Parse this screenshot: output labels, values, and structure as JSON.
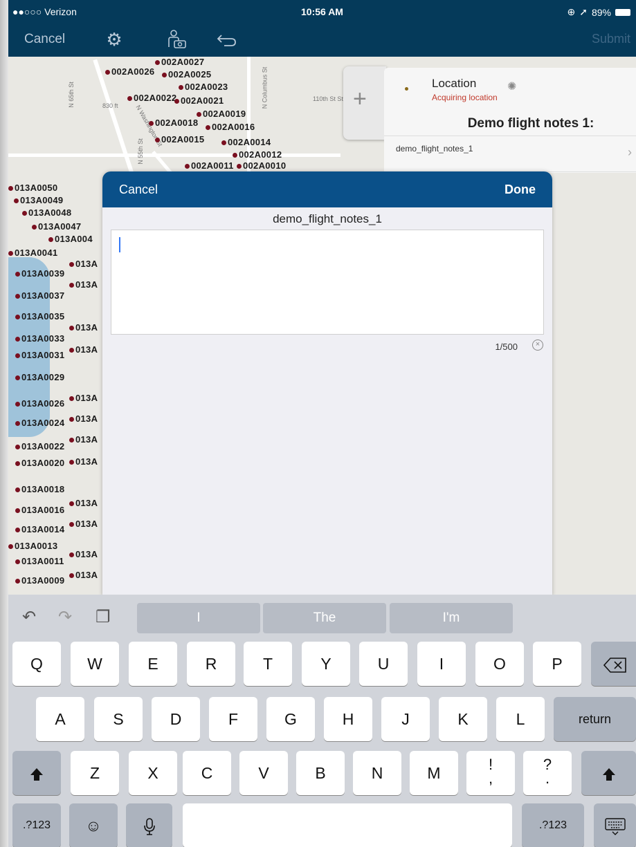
{
  "status": {
    "carrier": "●●○○○ Verizon",
    "time": "10:56 AM",
    "battery": "89%"
  },
  "nav": {
    "cancel": "Cancel",
    "submit": "Submit",
    "icons": [
      "gear-icon",
      "person-camera-icon",
      "undo-icon"
    ]
  },
  "map": {
    "top_labels": [
      "002A0027",
      "002A0026",
      "002A0025",
      "002A0023",
      "002A0022",
      "002A0021",
      "002A0019",
      "002A0018",
      "002A0016",
      "002A0015",
      "002A0014",
      "002A0012",
      "002A0011",
      "002A0010"
    ],
    "left_labels": [
      "013A0050",
      "013A0049",
      "013A0048",
      "013A0047",
      "013A004",
      "013A0041",
      "013A0039",
      "013A0037",
      "013A0035",
      "013A0033",
      "013A0031",
      "013A0029",
      "013A0026",
      "013A0024",
      "013A0022",
      "013A0020",
      "013A0018",
      "013A0016",
      "013A0014",
      "013A0013",
      "013A0011",
      "013A0009"
    ],
    "right_partial_label": "013A",
    "streets": [
      "N 65th St",
      "830 ft",
      "110th St St",
      "N Washington St",
      "N 55th St",
      "N Columbus St"
    ]
  },
  "location": {
    "title": "Location",
    "status": "Acquiring location",
    "heading": "Demo flight notes 1:",
    "row": "demo_flight_notes_1"
  },
  "modal": {
    "cancel": "Cancel",
    "done": "Done",
    "field_label": "demo_flight_notes_1",
    "value": "",
    "counter": "1/500"
  },
  "keyboard": {
    "suggestions": [
      "I",
      "The",
      "I'm"
    ],
    "row1": [
      "Q",
      "W",
      "E",
      "R",
      "T",
      "Y",
      "U",
      "I",
      "O",
      "P"
    ],
    "row2": [
      "A",
      "S",
      "D",
      "F",
      "G",
      "H",
      "J",
      "K",
      "L"
    ],
    "row3": [
      "Z",
      "X",
      "C",
      "V",
      "B",
      "N",
      "M"
    ],
    "return": "return",
    "numbers": ".?123",
    "punct1_top": "!",
    "punct1_bottom": ",",
    "punct2_top": "?",
    "punct2_bottom": "."
  }
}
